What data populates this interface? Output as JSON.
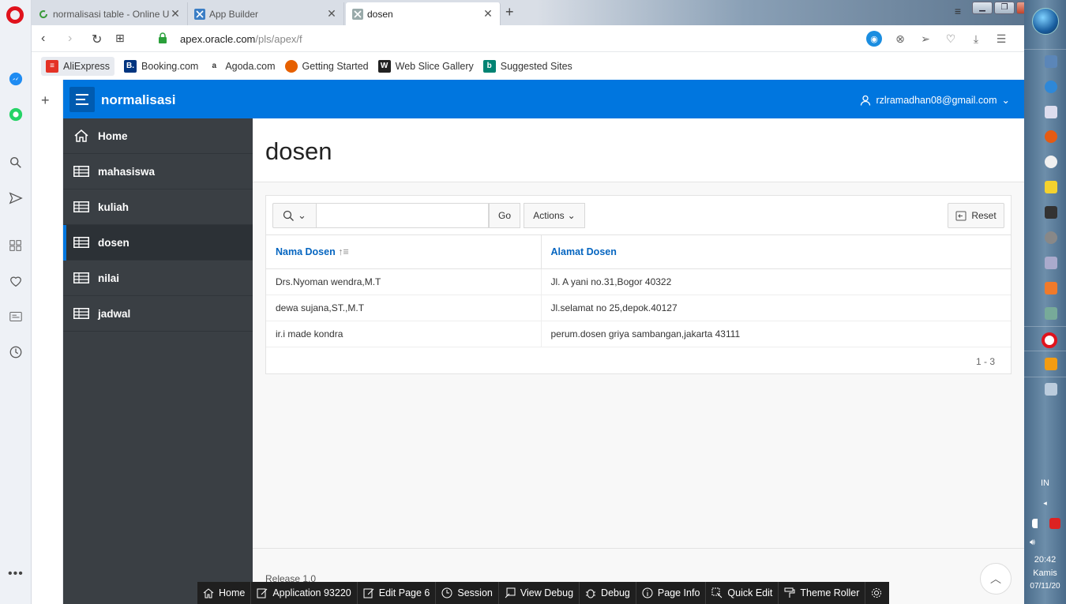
{
  "browser": {
    "tabs": [
      {
        "title": "normalisasi table - Online U",
        "icon": "refresh-green-icon"
      },
      {
        "title": "App Builder",
        "icon": "apex-icon"
      },
      {
        "title": "dosen",
        "icon": "apex-icon"
      }
    ],
    "url_host": "apex.oracle.com",
    "url_path": "/pls/apex/f",
    "url_prefix": "",
    "bookmarks": [
      {
        "label": "AliExpress",
        "color": "#e43225"
      },
      {
        "label": "Booking.com",
        "color": "#003580"
      },
      {
        "label": "Agoda.com",
        "color": "#ffffff"
      },
      {
        "label": "Getting Started",
        "color": "#e66000"
      },
      {
        "label": "Web Slice Gallery",
        "color": "#222222"
      },
      {
        "label": "Suggested Sites",
        "color": "#008373"
      }
    ]
  },
  "app": {
    "title": "normalisasi",
    "user": "rzlramadhan08@gmail.com",
    "accent": "#0076df"
  },
  "nav": {
    "items": [
      {
        "label": "Home",
        "icon": "home-icon"
      },
      {
        "label": "mahasiswa",
        "icon": "table-icon"
      },
      {
        "label": "kuliah",
        "icon": "table-icon"
      },
      {
        "label": "dosen",
        "icon": "table-icon",
        "active": true
      },
      {
        "label": "nilai",
        "icon": "table-icon"
      },
      {
        "label": "jadwal",
        "icon": "table-icon"
      }
    ]
  },
  "page": {
    "title": "dosen",
    "release": "Release 1.0"
  },
  "report": {
    "search_value": "",
    "go_label": "Go",
    "actions_label": "Actions",
    "reset_label": "Reset",
    "columns": [
      "Nama Dosen",
      "Alamat Dosen"
    ],
    "rows": [
      [
        "Drs.Nyoman wendra,M.T",
        "Jl. A yani no.31,Bogor 40322"
      ],
      [
        "dewa sujana,ST.,M.T",
        "Jl.selamat no 25,depok.40127"
      ],
      [
        "ir.i made kondra",
        "perum.dosen griya sambangan,jakarta 43111"
      ]
    ],
    "pagination": "1 - 3"
  },
  "devbar": {
    "items": [
      "Home",
      "Application 93220",
      "Edit Page 6",
      "Session",
      "View Debug",
      "Debug",
      "Page Info",
      "Quick Edit",
      "Theme Roller"
    ]
  },
  "taskbar": {
    "lang": "IN",
    "time": "20:42",
    "day": "Kamis",
    "date": "07/11/20"
  }
}
